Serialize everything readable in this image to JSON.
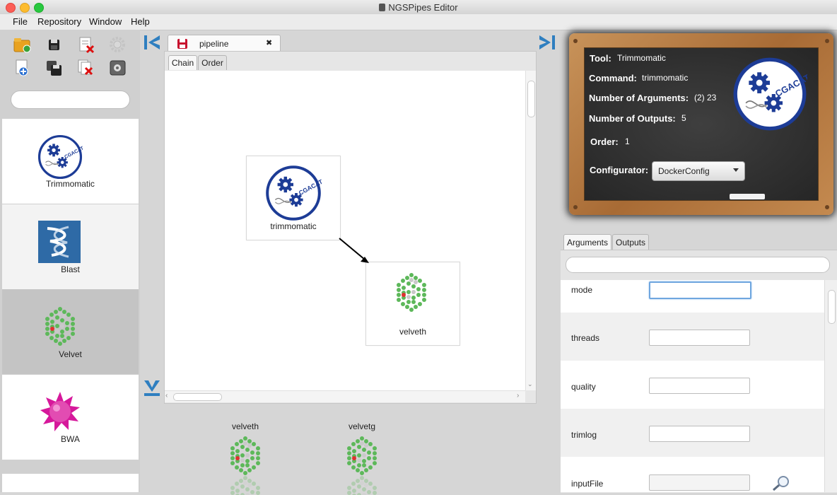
{
  "window": {
    "title": "NGSPipes Editor"
  },
  "menu": [
    "File",
    "Repository",
    "Window",
    "Help"
  ],
  "left_panel": {
    "tools": [
      {
        "name": "Trimmomatic",
        "icon": "cgacatat-gears-logo"
      },
      {
        "name": "Blast",
        "icon": "blast-helix-logo"
      },
      {
        "name": "Velvet",
        "icon": "velvet-hexagon-logo",
        "selected": true
      },
      {
        "name": "BWA",
        "icon": "bwa-spiky-ball-logo"
      }
    ]
  },
  "editor": {
    "tab_label": "pipeline",
    "tab_close": "✖",
    "subtabs": [
      "Chain",
      "Order"
    ],
    "nodes": [
      {
        "label": "trimmomatic"
      },
      {
        "label": "velveth"
      }
    ],
    "bottom_tools": [
      "velveth",
      "velvetg"
    ]
  },
  "board": {
    "logo_text": "CGACATAT",
    "fields": [
      {
        "key": "Tool:",
        "value": "Trimmomatic"
      },
      {
        "key": "Command:",
        "value": "trimmomatic"
      },
      {
        "key": "Number of Arguments:",
        "value": "(2) 23"
      },
      {
        "key": "Number of Outputs:",
        "value": "5"
      },
      {
        "key": "Order:",
        "value": "1"
      }
    ],
    "configurator_label": "Configurator:",
    "configurator_value": "DockerConfig"
  },
  "details": {
    "tabs": [
      "Arguments",
      "Outputs"
    ],
    "arguments": [
      {
        "name": "mode",
        "value": ""
      },
      {
        "name": "threads",
        "value": ""
      },
      {
        "name": "quality",
        "value": ""
      },
      {
        "name": "trimlog",
        "value": ""
      },
      {
        "name": "inputFile",
        "value": ""
      }
    ]
  },
  "colors": {
    "logo_blue": "#1d3c96",
    "velvet_green": "#5db85a",
    "velvet_red": "#e03030",
    "bwa_magenta": "#d6189b",
    "nav_arrow_blue": "#2f7fc0"
  }
}
